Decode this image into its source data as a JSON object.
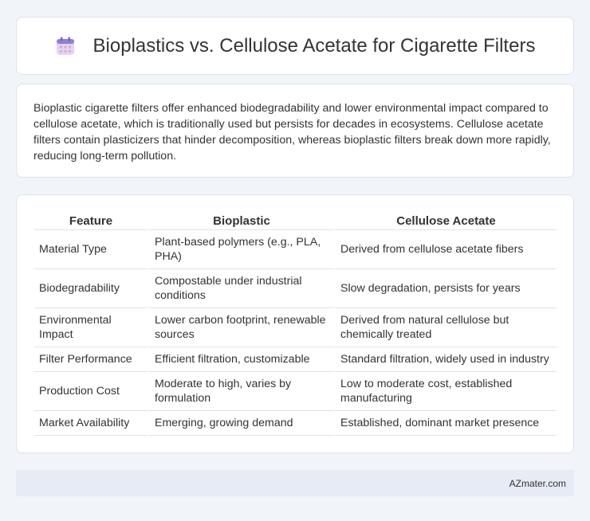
{
  "header": {
    "title": "Bioplastics vs. Cellulose Acetate for Cigarette Filters",
    "icon": "calendar-icon"
  },
  "summary": {
    "text": "Bioplastic cigarette filters offer enhanced biodegradability and lower environmental impact compared to cellulose acetate, which is traditionally used but persists for decades in ecosystems. Cellulose acetate filters contain plasticizers that hinder decomposition, whereas bioplastic filters break down more rapidly, reducing long-term pollution."
  },
  "table": {
    "headers": [
      "Feature",
      "Bioplastic",
      "Cellulose Acetate"
    ],
    "rows": [
      [
        "Material Type",
        "Plant-based polymers (e.g., PLA, PHA)",
        "Derived from cellulose acetate fibers"
      ],
      [
        "Biodegradability",
        "Compostable under industrial conditions",
        "Slow degradation, persists for years"
      ],
      [
        "Environmental Impact",
        "Lower carbon footprint, renewable sources",
        "Derived from natural cellulose but chemically treated"
      ],
      [
        "Filter Performance",
        "Efficient filtration, customizable",
        "Standard filtration, widely used in industry"
      ],
      [
        "Production Cost",
        "Moderate to high, varies by formulation",
        "Low to moderate cost, established manufacturing"
      ],
      [
        "Market Availability",
        "Emerging, growing demand",
        "Established, dominant market presence"
      ]
    ]
  },
  "footer": {
    "text": "AZmater.com"
  },
  "colors": {
    "background": "#f1f4f9",
    "card": "#ffffff",
    "border": "#dde3ec",
    "footer_bg": "#e6ebf5",
    "icon_accent": "#8b7fd6"
  }
}
